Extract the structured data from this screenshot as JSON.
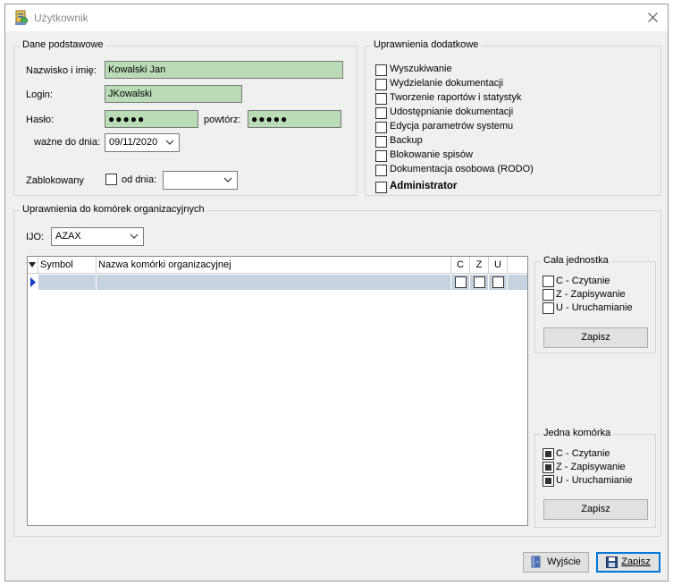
{
  "window": {
    "title": "Użytkownik"
  },
  "basic": {
    "group_title": "Dane podstawowe",
    "name_label": "Nazwisko i imię:",
    "name_value": "Kowalski Jan",
    "login_label": "Login:",
    "login_value": "JKowalski",
    "password_label": "Hasło:",
    "password_value": "●●●●●",
    "repeat_label": "powtórz:",
    "repeat_value": "●●●●●",
    "valid_label": "ważne do dnia:",
    "valid_value": "09/11/2020",
    "blocked_label": "Zablokowany",
    "from_label": "od dnia:",
    "from_value": ""
  },
  "extra": {
    "group_title": "Uprawnienia dodatkowe",
    "items": [
      {
        "label": "Wyszukiwanie",
        "checked": false
      },
      {
        "label": "Wydzielanie dokumentacji",
        "checked": false
      },
      {
        "label": "Tworzenie raportów i statystyk",
        "checked": false
      },
      {
        "label": "Udostępnianie dokumentacji",
        "checked": false
      },
      {
        "label": "Edycja parametrów systemu",
        "checked": false
      },
      {
        "label": "Backup",
        "checked": false
      },
      {
        "label": "Blokowanie spisów",
        "checked": false
      },
      {
        "label": "Dokumentacja osobowa (RODO)",
        "checked": false
      },
      {
        "label": "Administrator",
        "checked": false
      }
    ]
  },
  "org": {
    "group_title": "Uprawnienia do komórek organizacyjnych",
    "ijo_label": "IJO:",
    "ijo_value": "AZAX",
    "columns": {
      "symbol": "Symbol",
      "name": "Nazwa komórki organizacyjnej",
      "c": "C",
      "z": "Z",
      "u": "U"
    },
    "whole_unit": {
      "title": "Cała jednostka",
      "c": "C - Czytanie",
      "z": "Z - Zapisywanie",
      "u": "U -  Uruchamianie",
      "save": "Zapisz"
    },
    "single_cell": {
      "title": "Jedna komórka",
      "c": "C - Czytanie",
      "z": "Z - Zapisywanie",
      "u": "U -  Uruchamianie",
      "save": "Zapisz"
    }
  },
  "footer": {
    "exit": "Wyjście",
    "save": "Zapisz"
  }
}
